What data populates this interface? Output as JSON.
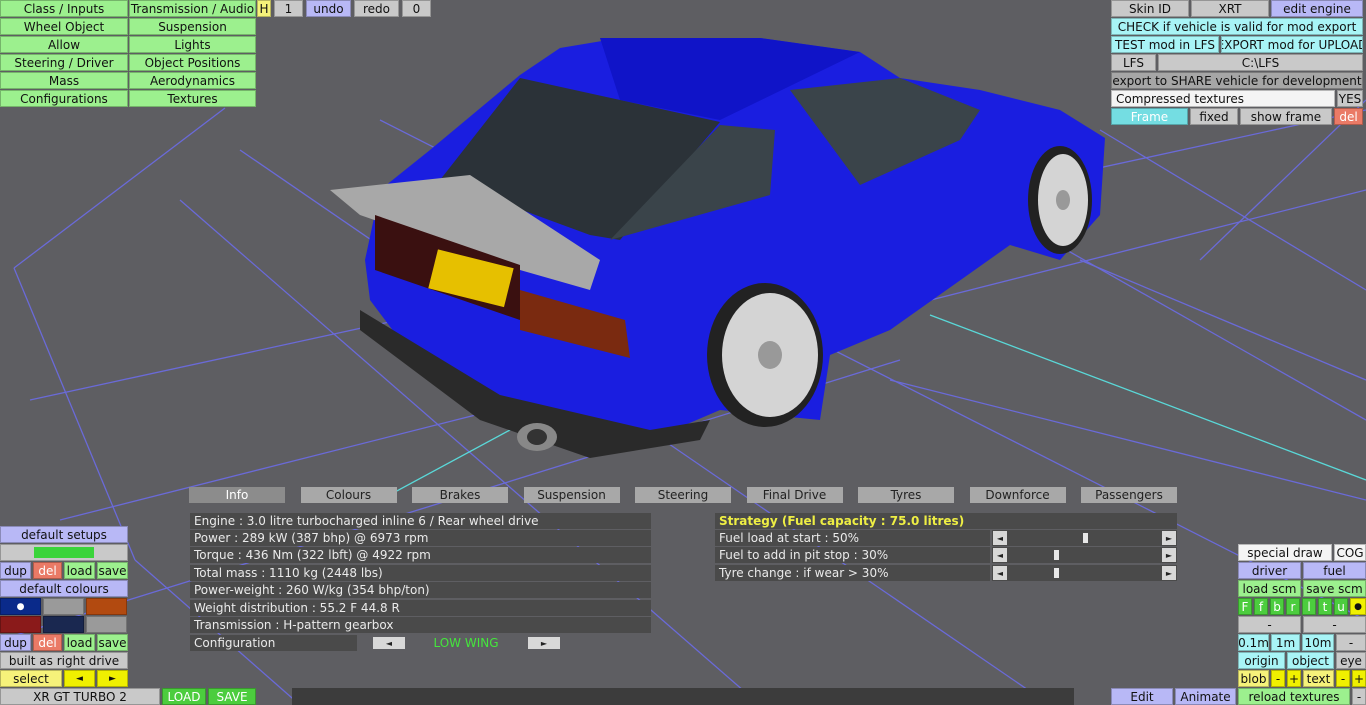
{
  "top_left_menu": [
    {
      "label": "Class / Inputs"
    },
    {
      "label": "Transmission / Audio"
    },
    {
      "label": "Wheel Object"
    },
    {
      "label": "Suspension"
    },
    {
      "label": "Allow"
    },
    {
      "label": "Lights"
    },
    {
      "label": "Steering / Driver"
    },
    {
      "label": "Object Positions"
    },
    {
      "label": "Mass"
    },
    {
      "label": "Aerodynamics"
    },
    {
      "label": "Configurations"
    },
    {
      "label": "Textures"
    }
  ],
  "toolbar": {
    "h_label": "H",
    "count": "1",
    "undo_label": "undo",
    "redo_label": "redo",
    "redo_count": "0"
  },
  "top_right": {
    "skin_id": "Skin ID",
    "xrt": "XRT",
    "edit_engine": "edit engine",
    "check_valid": "CHECK if vehicle is valid for mod export",
    "test_mod": "TEST mod in LFS",
    "export_mod": "EXPORT mod for UPLOAD",
    "lfs": "LFS",
    "lfs_path": "C:\\LFS",
    "export_share": "export to SHARE vehicle for development",
    "compressed_textures": "Compressed textures",
    "compressed_value": "YES",
    "frame": "Frame",
    "fixed": "fixed",
    "show_frame": "show frame",
    "del": "del"
  },
  "tabs": [
    {
      "label": "Info"
    },
    {
      "label": "Colours"
    },
    {
      "label": "Brakes"
    },
    {
      "label": "Suspension"
    },
    {
      "label": "Steering"
    },
    {
      "label": "Final Drive"
    },
    {
      "label": "Tyres"
    },
    {
      "label": "Downforce"
    },
    {
      "label": "Passengers"
    }
  ],
  "info": {
    "engine": "Engine : 3.0 litre turbocharged inline 6 / Rear wheel drive",
    "power": "Power : 289 kW (387 bhp) @ 6973 rpm",
    "torque": "Torque : 436 Nm (322 lbft) @ 4922 rpm",
    "mass": "Total mass : 1110 kg (2448 lbs)",
    "power_weight": "Power-weight : 260 W/kg (354 bhp/ton)",
    "weight_dist": "Weight distribution : 55.2 F  44.8 R",
    "transmission": "Transmission : H-pattern gearbox",
    "configuration_label": "Configuration",
    "configuration_value": "LOW WING"
  },
  "strategy": {
    "title": "Strategy (Fuel capacity : 75.0 litres)",
    "fuel_load": "Fuel load at start : 50%",
    "fuel_pit": "Fuel to add in pit stop : 30%",
    "tyre_change": "Tyre change : if wear > 30%",
    "fuel_load_value": 0.5,
    "fuel_pit_value": 0.3,
    "tyre_change_value": 0.3
  },
  "bottom_left": {
    "default_setups": "default setups",
    "setup_name": "",
    "dup": "dup",
    "del": "del",
    "load": "load",
    "save": "save",
    "default_colours": "default colours",
    "built_right": "built as right drive",
    "select": "select",
    "car_name": "XR GT TURBO 2",
    "load_btn": "LOAD",
    "save_btn": "SAVE",
    "swatches": [
      "#0a2a8a",
      "#9a9a9a",
      "#b24a10",
      "#8a1a1a",
      "#1a2850",
      "#9a9a9a"
    ]
  },
  "bottom_right": {
    "special_draw": "special draw",
    "cog": "COG",
    "driver": "driver",
    "fuel": "fuel",
    "load_scm": "load scm",
    "save_scm": "save scm",
    "flags": [
      "F",
      "f",
      "b",
      "r",
      "l",
      "t",
      "u"
    ],
    "minus": "-",
    "m01": "0.1m",
    "m1": "1m",
    "m10": "10m",
    "origin": "origin",
    "object": "object",
    "eye": "eye",
    "blob": "blob",
    "text": "text",
    "reload": "reload textures",
    "edit": "Edit",
    "animate": "Animate"
  },
  "colors": {
    "car_body": "#1a1ee0",
    "background": "#5e5e62",
    "grid": "#6a6ad8"
  }
}
